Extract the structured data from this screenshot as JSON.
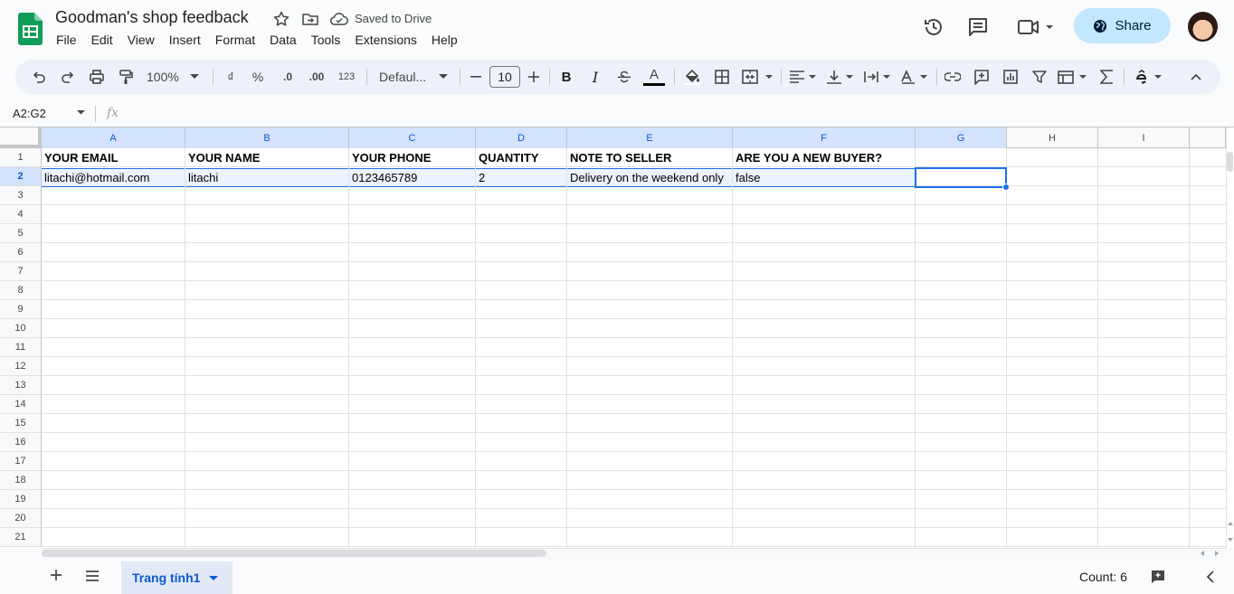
{
  "header": {
    "title": "Goodman's shop feedback",
    "saved_status": "Saved to Drive",
    "share_label": "Share",
    "menu": [
      "File",
      "Edit",
      "View",
      "Insert",
      "Format",
      "Data",
      "Tools",
      "Extensions",
      "Help"
    ]
  },
  "toolbar": {
    "zoom": "100%",
    "currency_symbol": "₫",
    "percent_symbol": "%",
    "dec_decrease": ".0",
    "dec_increase": ".00",
    "more_formats": "123",
    "font": "Defaul...",
    "font_size": "10",
    "bold": "B",
    "italic": "I",
    "text_color_letter": "A"
  },
  "formula_bar": {
    "name_box": "A2:G2",
    "fx": "fx"
  },
  "grid": {
    "columns": [
      "A",
      "B",
      "C",
      "D",
      "E",
      "F",
      "G",
      "H",
      "I"
    ],
    "selected_columns": [
      "A",
      "B",
      "C",
      "D",
      "E",
      "F",
      "G"
    ],
    "rows": [
      "1",
      "2",
      "3",
      "4",
      "5",
      "6",
      "7",
      "8",
      "9",
      "10",
      "11",
      "12",
      "13",
      "14",
      "15",
      "16",
      "17",
      "18",
      "19",
      "20",
      "21"
    ],
    "selected_row": "2",
    "data": [
      [
        "YOUR EMAIL",
        "YOUR NAME",
        "YOUR PHONE",
        "QUANTITY",
        "NOTE TO SELLER",
        "ARE YOU A NEW BUYER?"
      ],
      [
        "litachi@hotmail.com",
        "litachi",
        "0123465789",
        "2",
        "Delivery on the weekend only",
        "false"
      ]
    ]
  },
  "bottom_bar": {
    "sheet_name": "Trang tính1",
    "count": "Count: 6"
  },
  "colors": {
    "accent": "#1a73e8",
    "share_bg": "#c2e7ff",
    "toolbar_bg": "#edf2fa",
    "sheets_green": "#0f9d58"
  }
}
